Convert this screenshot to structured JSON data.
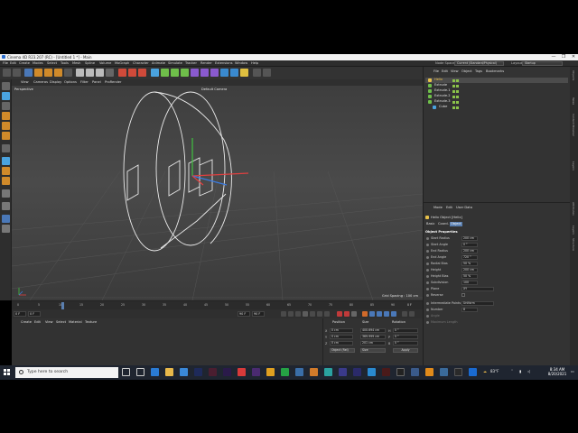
{
  "window": {
    "title": "Cinema 4D R23.207 (RC) - [Untitled 1 *] - Main",
    "controls": [
      "—",
      "❐",
      "✕"
    ]
  },
  "menubar": {
    "items": [
      "File",
      "Edit",
      "Create",
      "Modes",
      "Select",
      "Tools",
      "Mesh",
      "Spline",
      "Volume",
      "MoGraph",
      "Character",
      "Animate",
      "Simulate",
      "Tracker",
      "Render",
      "Extensions",
      "Window",
      "Help"
    ],
    "node_space_label": "Node Space:",
    "node_space_value": "Current (Standard/Physical)",
    "layout_label": "Layout:",
    "layout_value": "Startup"
  },
  "viewport": {
    "menu": [
      "View",
      "Cameras",
      "Display",
      "Options",
      "Filter",
      "Panel",
      "ProRender"
    ],
    "view_name": "Perspective",
    "camera": "Default Camera",
    "grid_spacing": "Grid Spacing : 100 cm"
  },
  "timeline": {
    "ticks": [
      "0",
      "5",
      "10",
      "15",
      "20",
      "25",
      "30",
      "35",
      "40",
      "45",
      "50",
      "55",
      "60",
      "65",
      "70",
      "75",
      "80",
      "85",
      "90"
    ],
    "current_frame": "0 F",
    "start": "0 F",
    "end": "90 F",
    "end2": "90 F",
    "marker": "0 F"
  },
  "material_manager": {
    "menu": [
      "Create",
      "Edit",
      "View",
      "Select",
      "Material",
      "Texture"
    ]
  },
  "coordinates": {
    "headers": [
      "Position",
      "Size",
      "Rotation"
    ],
    "rows": [
      {
        "axis": "X",
        "pos": "0 cm",
        "size": "400.694 cm",
        "rot_axis": "H",
        "rot": "0 °"
      },
      {
        "axis": "Y",
        "pos": "0 cm",
        "size": "369.999 cm",
        "rot_axis": "P",
        "rot": "0 °"
      },
      {
        "axis": "Z",
        "pos": "0 cm",
        "size": "201 cm",
        "rot_axis": "B",
        "rot": "0 °"
      }
    ],
    "mode": "Object (Rel)",
    "size_mode": "Size",
    "apply": "Apply"
  },
  "object_manager": {
    "menu": [
      "File",
      "Edit",
      "View",
      "Object",
      "Tags",
      "Bookmarks"
    ],
    "objects": [
      {
        "name": "Helix",
        "color": "#e8c14a",
        "selected": true
      },
      {
        "name": "Extrude",
        "color": "#6fbf4a",
        "selected": false
      },
      {
        "name": "Extrude.1",
        "color": "#6fbf4a",
        "selected": false
      },
      {
        "name": "Extrude.2",
        "color": "#6fbf4a",
        "selected": false
      },
      {
        "name": "Extrude.3",
        "color": "#6fbf4a",
        "selected": false
      },
      {
        "name": "Cube",
        "color": "#4aa3df",
        "selected": false
      }
    ]
  },
  "attribute_manager": {
    "menu": [
      "Mode",
      "Edit",
      "User Data"
    ],
    "object_title": "Helix Object [Helix]",
    "tabs": [
      "Basic",
      "Coord.",
      "Object"
    ],
    "active_tab": "Object",
    "section": "Object Properties",
    "properties": [
      {
        "label": "Start Radius",
        "value": "200 cm"
      },
      {
        "label": "Start Angle",
        "value": "0 °"
      },
      {
        "label": "End Radius",
        "value": "200 cm"
      },
      {
        "label": "End Angle",
        "value": "720 °"
      },
      {
        "label": "Radial Bias",
        "value": "50 %"
      },
      {
        "label": "Height",
        "value": "200 cm"
      },
      {
        "label": "Height Bias",
        "value": "50 %"
      },
      {
        "label": "Subdivision",
        "value": "100"
      },
      {
        "label": "Plane",
        "value": "XY"
      },
      {
        "label": "Reverse",
        "value": ""
      },
      {
        "label": "Intermediate Points",
        "value": "Uniform"
      },
      {
        "label": "Number",
        "value": "8"
      },
      {
        "label": "Angle",
        "value": "5 °"
      },
      {
        "label": "Maximum Length",
        "value": "5 cm"
      }
    ]
  },
  "side_tabs": [
    "Objects",
    "Takes",
    "Content Browser",
    "Layers",
    "Attributes",
    "Layers",
    "Structure"
  ],
  "taskbar": {
    "search_placeholder": "Type here to search",
    "temperature": "83°F",
    "time": "8:34 AM",
    "date": "8/20/2021"
  },
  "colors": {
    "accent": "#5a7fb0",
    "axis_x": "#e04040",
    "axis_y": "#40c040",
    "axis_z": "#3a7be0"
  }
}
